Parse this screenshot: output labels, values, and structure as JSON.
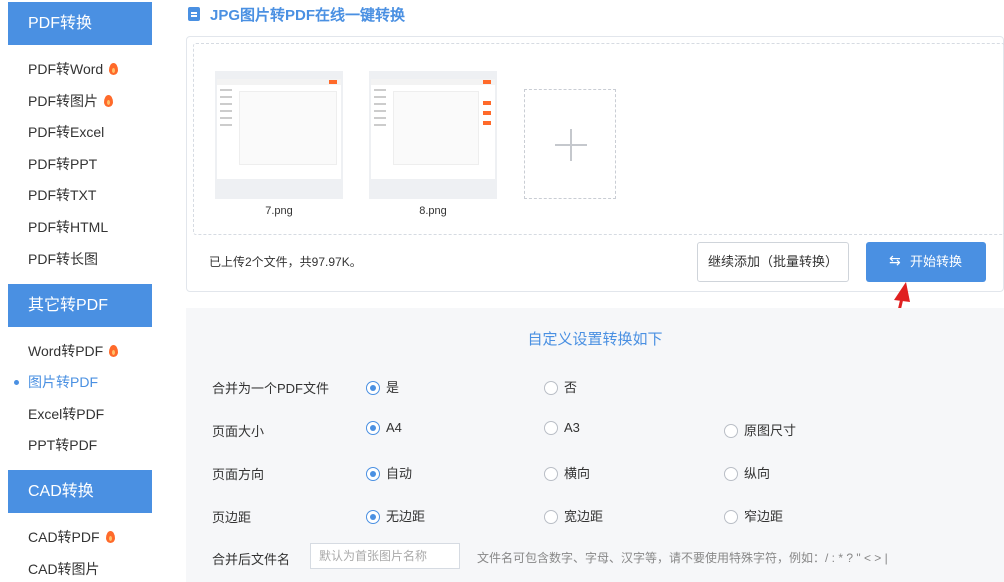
{
  "sidebar": {
    "sections": [
      {
        "title": "PDF转换",
        "items": [
          {
            "label": "PDF转Word",
            "hot": true
          },
          {
            "label": "PDF转图片",
            "hot": true
          },
          {
            "label": "PDF转Excel",
            "hot": false
          },
          {
            "label": "PDF转PPT",
            "hot": false
          },
          {
            "label": "PDF转TXT",
            "hot": false
          },
          {
            "label": "PDF转HTML",
            "hot": false
          },
          {
            "label": "PDF转长图",
            "hot": false
          }
        ]
      },
      {
        "title": "其它转PDF",
        "items": [
          {
            "label": "Word转PDF",
            "hot": true
          },
          {
            "label": "图片转PDF",
            "hot": false,
            "active": true
          },
          {
            "label": "Excel转PDF",
            "hot": false
          },
          {
            "label": "PPT转PDF",
            "hot": false
          }
        ]
      },
      {
        "title": "CAD转换",
        "items": [
          {
            "label": "CAD转PDF",
            "hot": true
          },
          {
            "label": "CAD转图片",
            "hot": false
          }
        ]
      }
    ],
    "hot_icon": "fire-icon"
  },
  "main": {
    "title": "JPG图片转PDF在线一键转换",
    "title_icon": "document-icon",
    "files": [
      {
        "name": "7.png"
      },
      {
        "name": "8.png"
      }
    ],
    "add_icon": "plus-icon",
    "status": "已上传2个文件，共97.97K。",
    "add_more_label": "继续添加（批量转换）",
    "start_label": "开始转换",
    "start_icon": "swap-icon"
  },
  "settings": {
    "title": "自定义设置转换如下",
    "merge": {
      "label": "合并为一个PDF文件",
      "options": [
        "是",
        "否"
      ],
      "selected": "是"
    },
    "page_size": {
      "label": "页面大小",
      "options": [
        "A4",
        "A3",
        "原图尺寸"
      ],
      "selected": "A4"
    },
    "orientation": {
      "label": "页面方向",
      "options": [
        "自动",
        "横向",
        "纵向"
      ],
      "selected": "自动"
    },
    "margin": {
      "label": "页边距",
      "options": [
        "无边距",
        "宽边距",
        "窄边距"
      ],
      "selected": "无边距"
    },
    "filename": {
      "label": "合并后文件名",
      "placeholder": "默认为首张图片名称",
      "hint": "文件名可包含数字、字母、汉字等，请不要使用特殊字符，例如：/ : * ? \" < > |"
    }
  },
  "colors": {
    "accent": "#4a90e2",
    "hot": "#ff6a2a",
    "annotation": "#e02020"
  }
}
